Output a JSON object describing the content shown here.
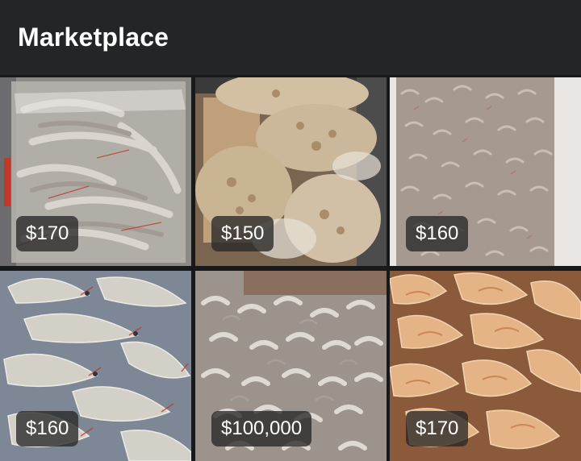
{
  "header": {
    "title": "Marketplace"
  },
  "listings": [
    {
      "price": "$170",
      "photo": "shrimp-in-clear-bag-photo"
    },
    {
      "price": "$150",
      "photo": "frozen-shrimp-bags-photo"
    },
    {
      "price": "$160",
      "photo": "small-shrimp-in-cooler-photo"
    },
    {
      "price": "$160",
      "photo": "large-raw-shrimp-photo"
    },
    {
      "price": "$100,000",
      "photo": "pile-of-shrimp-photo"
    },
    {
      "price": "$170",
      "photo": "orange-shrimp-pile-photo"
    }
  ],
  "colors": {
    "header_bg": "#242526",
    "grid_bg": "#18191a",
    "price_badge_bg": "rgba(40,40,40,0.78)",
    "text": "#ffffff"
  }
}
